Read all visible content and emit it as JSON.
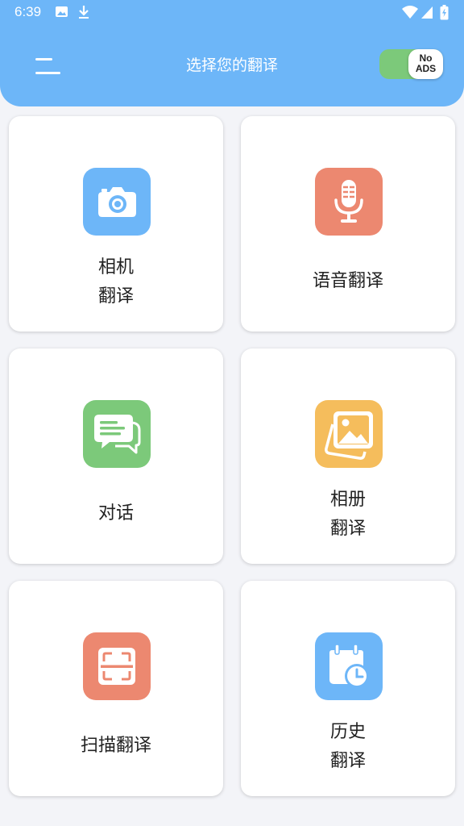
{
  "status_bar": {
    "time": "6:39",
    "icons": [
      "image-icon",
      "download-icon",
      "wifi-icon",
      "signal-icon",
      "battery-icon"
    ]
  },
  "header": {
    "title": "选择您的翻译",
    "menu_icon": "menu-icon",
    "ads_toggle": {
      "line1": "No",
      "line2": "ADS",
      "on_color": "#7cc97a"
    },
    "background": "#6db6f8"
  },
  "cards": [
    {
      "id": "camera",
      "line1": "相机",
      "line2": "翻译",
      "icon": "camera-icon",
      "color": "#6db6f8"
    },
    {
      "id": "voice",
      "line1": "语音翻译",
      "line2": "",
      "icon": "microphone-icon",
      "color": "#ec8870"
    },
    {
      "id": "dialogue",
      "line1": "对话",
      "line2": "",
      "icon": "chat-icon",
      "color": "#7cc97a"
    },
    {
      "id": "album",
      "line1": "相册",
      "line2": "翻译",
      "icon": "photo-album-icon",
      "color": "#f5bd5c"
    },
    {
      "id": "scan",
      "line1": "扫描翻译",
      "line2": "",
      "icon": "scan-icon",
      "color": "#ec8870"
    },
    {
      "id": "history",
      "line1": "历史",
      "line2": "翻译",
      "icon": "calendar-clock-icon",
      "color": "#6db6f8"
    }
  ]
}
